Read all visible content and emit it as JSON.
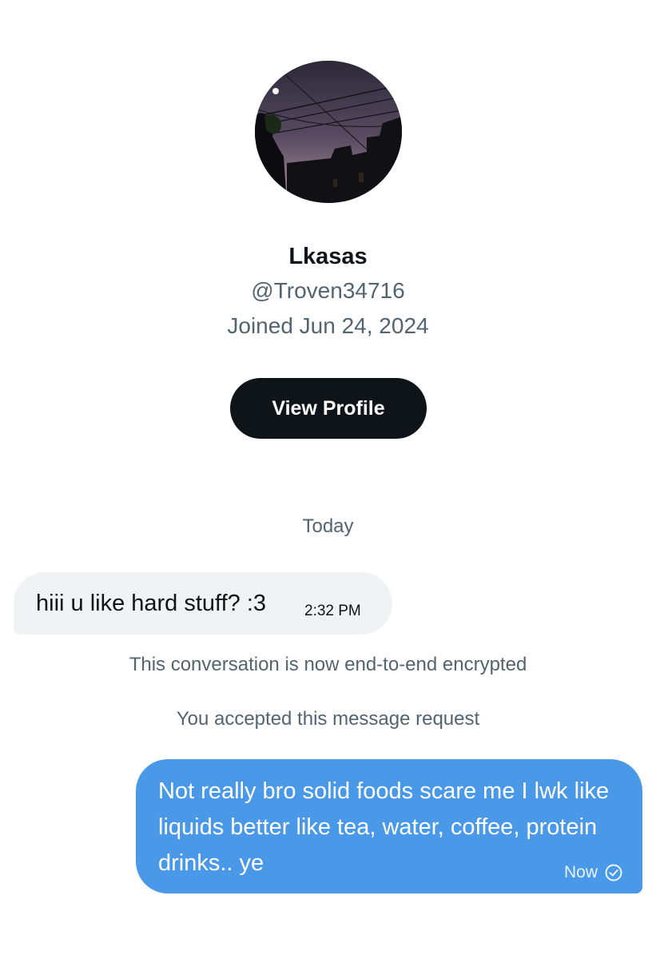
{
  "profile": {
    "display_name": "Lkasas",
    "handle": "@Troven34716",
    "joined": "Joined Jun 24, 2024",
    "view_profile_label": "View Profile",
    "avatar_icon": "evening-sky-photo"
  },
  "conversation": {
    "date_separator": "Today",
    "messages": [
      {
        "direction": "incoming",
        "text": "hiii u like hard stuff? :3",
        "time": "2:32 PM"
      },
      {
        "direction": "outgoing",
        "text": "Not really bro solid foods scare me I lwk like liquids better like tea, water, coffee, protein drinks.. ye",
        "time": "Now",
        "status_icon": "check-circle-icon"
      }
    ],
    "system_messages": [
      "This conversation is now end-to-end encrypted",
      "You accepted this message request"
    ]
  },
  "colors": {
    "outgoing_bubble": "#4a99e9",
    "incoming_bubble": "#eff3f4",
    "button_bg": "#0f1419",
    "secondary_text": "#536471"
  }
}
